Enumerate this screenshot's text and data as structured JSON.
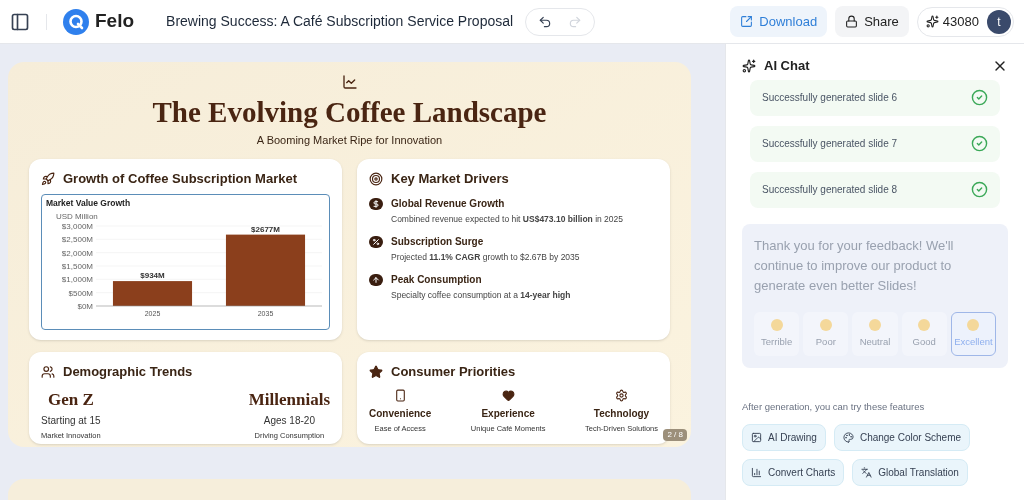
{
  "header": {
    "app_name": "Felo",
    "title": "Brewing Success: A Café Subscription Service Proposal",
    "history": [
      {
        "kind": "undo",
        "disabled": false
      },
      {
        "kind": "redo",
        "disabled": true
      }
    ],
    "download": "Download",
    "share": "Share",
    "credits": "43080",
    "avatar": "t"
  },
  "slide": {
    "title": "The Evolving Coffee Landscape",
    "subtitle": "A Booming Market Ripe for Innovation",
    "page": "2 / 8",
    "growth": {
      "heading": "Growth of Coffee Subscription Market",
      "chart_data": {
        "type": "bar",
        "title": "Market Value Growth",
        "ylabel": "USD Million",
        "categories": [
          "2025",
          "2035"
        ],
        "values": [
          934,
          2677
        ],
        "ylim": [
          0,
          3000
        ],
        "yticks": [
          {
            "value": 0,
            "label": "$0M"
          },
          {
            "value": 500,
            "label": "$500M"
          },
          {
            "value": 1000,
            "label": "$1,000M"
          },
          {
            "value": 1500,
            "label": "$1,500M"
          },
          {
            "value": 2000,
            "label": "$2,000M"
          },
          {
            "value": 2500,
            "label": "$2,500M"
          },
          {
            "value": 3000,
            "label": "$3,000M"
          }
        ],
        "data_labels": true,
        "grid": true,
        "value_labels": [
          "$934M",
          "$2677M"
        ]
      }
    },
    "drivers": {
      "heading": "Key Market Drivers",
      "items": [
        {
          "kind": "dollar",
          "title": "Global Revenue Growth",
          "text": "Combined revenue expected to hit **US$473.10 billion** in 2025"
        },
        {
          "kind": "percent",
          "title": "Subscription Surge",
          "text": "Projected **11.1% CAGR** growth to $2.67B by 2035"
        },
        {
          "kind": "up",
          "title": "Peak Consumption",
          "text": "Specialty coffee consumption at a **14-year high**"
        }
      ]
    },
    "demographics": {
      "heading": "Demographic Trends",
      "groups": [
        {
          "name": "Gen Z",
          "detail": "Starting at 15",
          "note": "Market Innovation"
        },
        {
          "name": "Millennials",
          "detail": "Ages 18-20",
          "note": "Driving Consumption"
        }
      ]
    },
    "priorities": {
      "heading": "Consumer Priorities",
      "items": [
        {
          "kind": "phone",
          "title": "Convenience",
          "note": "Ease of Access"
        },
        {
          "kind": "heart",
          "title": "Experience",
          "note": "Unique Café Moments"
        },
        {
          "kind": "gear",
          "title": "Technology",
          "note": "Tech-Driven Solutions"
        }
      ]
    }
  },
  "chat": {
    "title": "AI Chat",
    "messages": [
      "Successfully generated slide 6",
      "Successfully generated slide 7",
      "Successfully generated slide 8"
    ],
    "feedback": {
      "text": "Thank you for your feedback! We'll continue to improve our product to generate even better Slides!",
      "ratings": [
        {
          "label": "Terrible",
          "selected": false
        },
        {
          "label": "Poor",
          "selected": false
        },
        {
          "label": "Neutral",
          "selected": false
        },
        {
          "label": "Good",
          "selected": false
        },
        {
          "label": "Excellent",
          "selected": true
        }
      ]
    },
    "features_intro": "After generation, you can try these features",
    "features": [
      {
        "kind": "image",
        "label": "AI Drawing"
      },
      {
        "kind": "palette",
        "label": "Change Color Scheme"
      },
      {
        "kind": "chart",
        "label": "Convert Charts"
      },
      {
        "kind": "translate",
        "label": "Global Translation"
      }
    ]
  }
}
